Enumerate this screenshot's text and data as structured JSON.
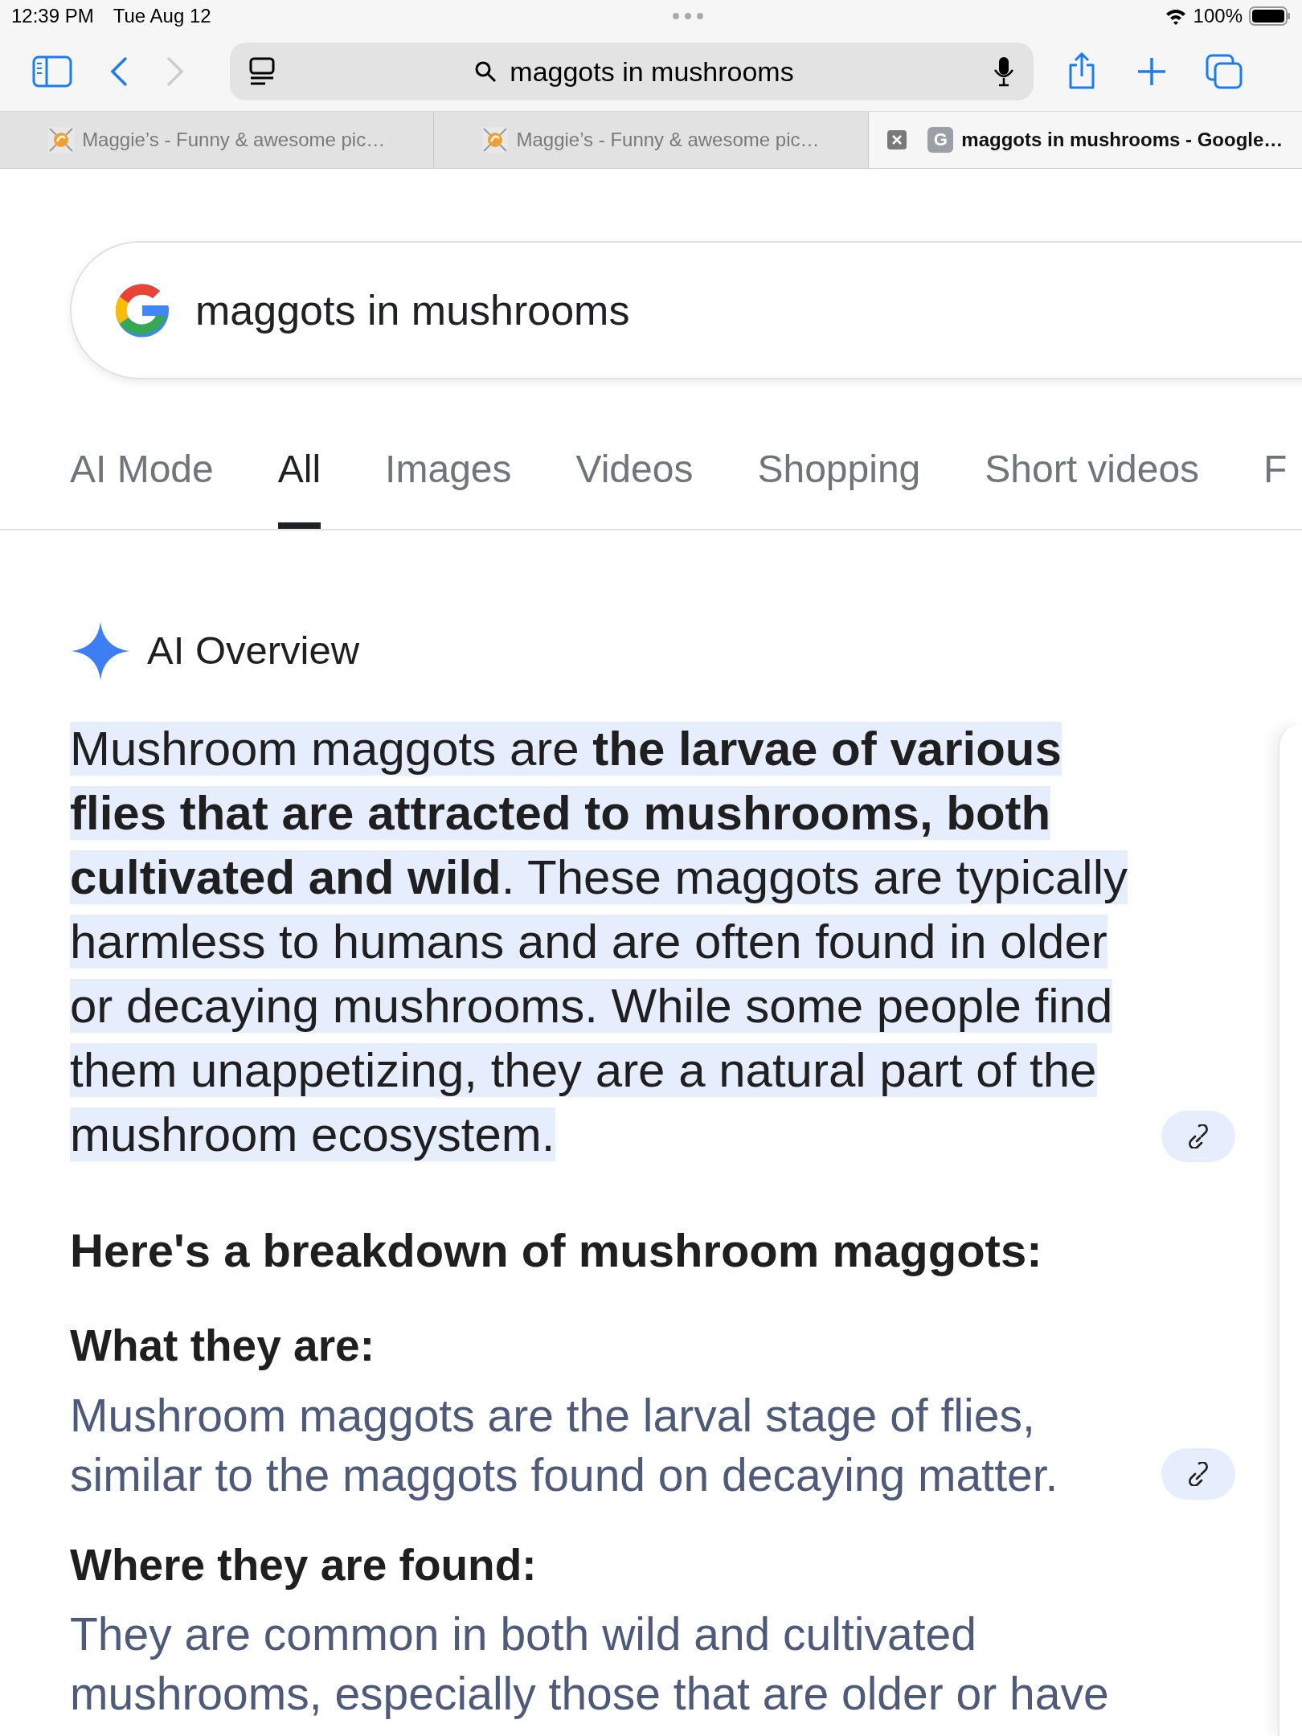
{
  "status_bar": {
    "time": "12:39 PM",
    "date": "Tue Aug 12",
    "battery": "100%"
  },
  "toolbar": {
    "address": "maggots in mushrooms",
    "back_enabled": true,
    "forward_enabled": false
  },
  "browser_tabs": [
    {
      "title": "Maggie’s - Funny & awesome pic…",
      "selected": false
    },
    {
      "title": "Maggie’s - Funny & awesome pic…",
      "selected": false
    },
    {
      "title": "maggots in mushrooms - Google…",
      "favicon_letter": "G",
      "selected": true
    }
  ],
  "search": {
    "query": "maggots in mushrooms"
  },
  "nav_tabs": [
    {
      "label": "AI Mode",
      "selected": false
    },
    {
      "label": "All",
      "selected": true
    },
    {
      "label": "Images",
      "selected": false
    },
    {
      "label": "Videos",
      "selected": false
    },
    {
      "label": "Shopping",
      "selected": false
    },
    {
      "label": "Short videos",
      "selected": false
    },
    {
      "label": "F",
      "selected": false
    }
  ],
  "ai_overview": {
    "title": "AI Overview",
    "summary": {
      "text": "Mushroom maggots are **the larvae of various flies that are attracted to mushrooms, both cultivated and wild**. These maggots are typically harmless to humans and are often found in older or decaying mushrooms. While some people find them unappetizing, they are a natural part of the mushroom ecosystem.",
      "highlighted": true,
      "link": true
    },
    "breakdown_heading": "Here's a breakdown of mushroom maggots:",
    "sections": [
      {
        "heading": "What they are:",
        "text": "Mushroom maggots are the larval stage of flies, similar to the maggots found on decaying matter.",
        "link": true
      },
      {
        "heading": "Where they are found:",
        "text": "They are common in both wild and cultivated mushrooms, especially those that are older or have"
      }
    ]
  }
}
